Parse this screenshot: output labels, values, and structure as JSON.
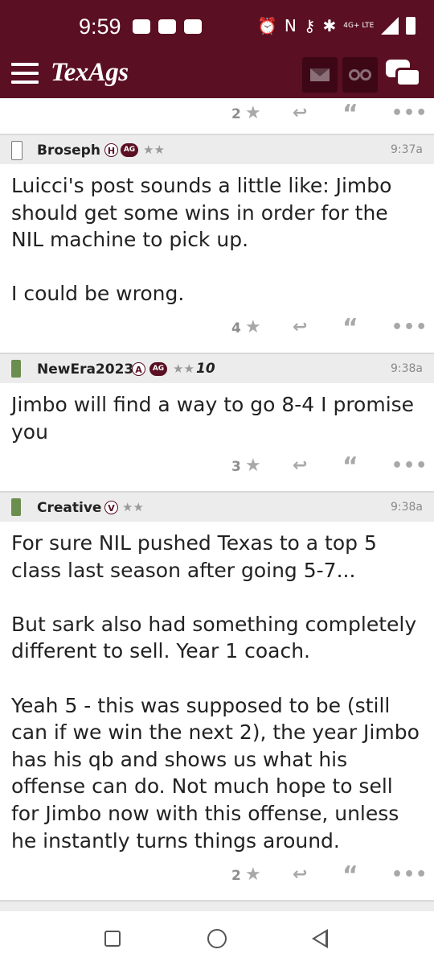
{
  "status_bar": {
    "time": "9:59",
    "network": "4G+ LTE"
  },
  "app_bar": {
    "logo": "TexAgs"
  },
  "top_actions": {
    "count": "2"
  },
  "posts": [
    {
      "username": "Broseph",
      "badges": [
        "H",
        "AG"
      ],
      "stars": "★★",
      "time": "9:37a",
      "body": "Luicci's post sounds a little like: Jimbo should get some wins in order for the NIL machine to pick up.\n\nI could be wrong.",
      "count": "4"
    },
    {
      "username": "NewEra2023",
      "badges": [
        "A",
        "AG"
      ],
      "stars": "★★",
      "extra": "10",
      "time": "9:38a",
      "body": "Jimbo will find a way to go 8-4 I promise you",
      "count": "3"
    },
    {
      "username": "Creative",
      "badges": [
        "V"
      ],
      "stars": "★★",
      "time": "9:38a",
      "body": "For sure NIL pushed Texas to a top 5 class last season after going 5-7...\n\nBut sark also had something completely different to sell. Year 1 coach.\n\nYeah 5 - this was supposed to be (still can if we win the next 2), the year Jimbo has his qb and shows us what his offense can do. Not much hope to sell for Jimbo now with this offense, unless he instantly turns things around.",
      "count": "2"
    }
  ],
  "icons": {
    "star": "★",
    "reply": "↩",
    "quote": "“",
    "more": "•••"
  },
  "colors": {
    "brand": "#5a0f23"
  }
}
